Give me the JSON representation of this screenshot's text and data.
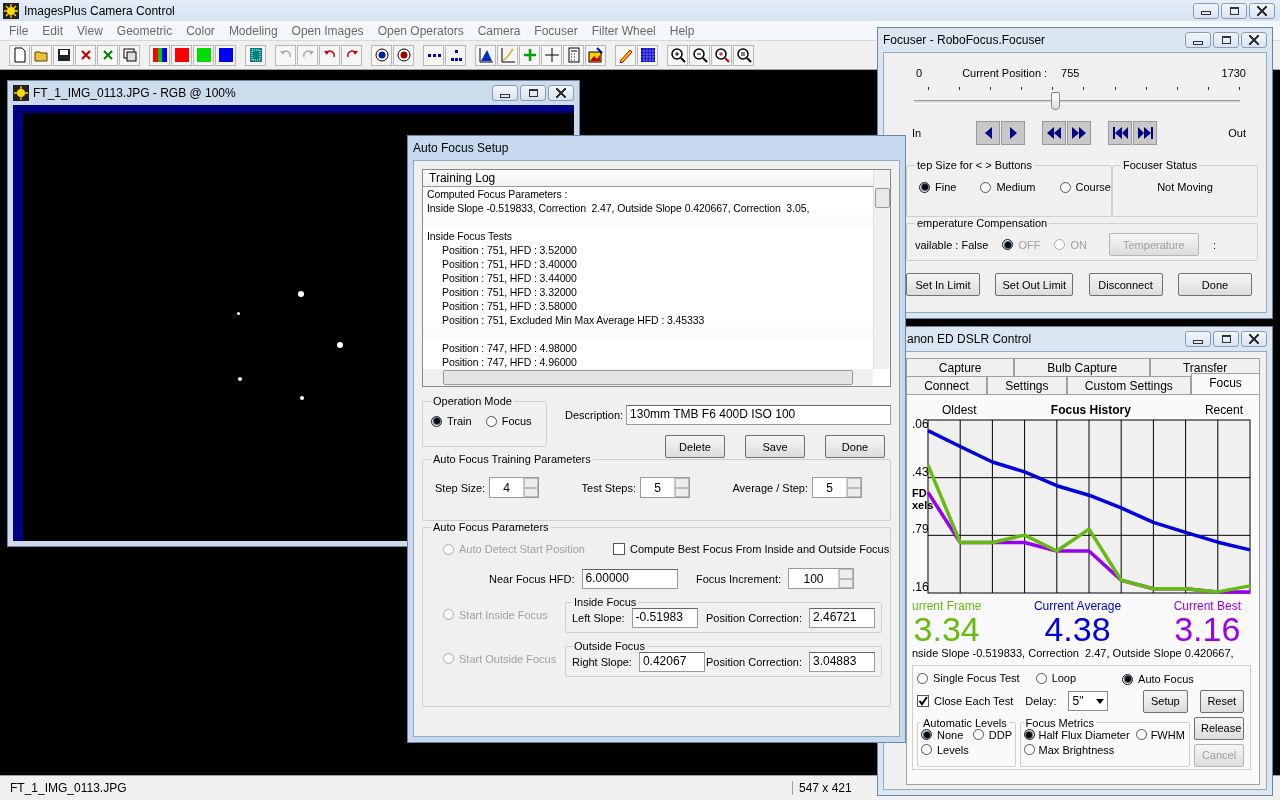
{
  "app": {
    "title": "ImagesPlus Camera Control"
  },
  "menu": [
    "File",
    "Edit",
    "View",
    "Geometric",
    "Color",
    "Modeling",
    "Open Images",
    "Open Operators",
    "Camera",
    "Focuser",
    "Filter Wheel",
    "Help"
  ],
  "image_window": {
    "title": "FT_1_IMG_0113.JPG - RGB @ 100%"
  },
  "status_bar": {
    "file_name": "FT_1_IMG_0113.JPG",
    "image_size": "547 x 421"
  },
  "auto_focus_setup": {
    "title": "Auto Focus Setup",
    "log": {
      "header": "Training Log",
      "lines": [
        {
          "kind": "heading",
          "text": "Computed Focus Parameters :",
          "gap_before": false
        },
        {
          "kind": "heading",
          "text": "Inside Slope -0.519833, Correction  2.47, Outside Slope 0.420667, Correction  3.05,",
          "gap_before": false
        },
        {
          "kind": "heading",
          "text": "Inside Focus Tests",
          "gap_before": true
        },
        {
          "kind": "entry",
          "text": "Position : 751, HFD : 3.52000",
          "gap_before": false
        },
        {
          "kind": "entry",
          "text": "Position : 751, HFD : 3.40000",
          "gap_before": false
        },
        {
          "kind": "entry",
          "text": "Position : 751, HFD : 3.44000",
          "gap_before": false
        },
        {
          "kind": "entry",
          "text": "Position : 751, HFD : 3.32000",
          "gap_before": false
        },
        {
          "kind": "entry",
          "text": "Position : 751, HFD : 3.58000",
          "gap_before": false
        },
        {
          "kind": "entry",
          "text": "Position : 751, Excluded Min Max Average HFD : 3.45333",
          "gap_before": false
        },
        {
          "kind": "entry",
          "text": "Position : 747, HFD : 4.98000",
          "gap_before": true
        },
        {
          "kind": "entry",
          "text": "Position : 747, HFD : 4.96000",
          "gap_before": false
        }
      ]
    },
    "operation_mode": {
      "label": "Operation Mode",
      "options": [
        {
          "label": "Train",
          "selected": true
        },
        {
          "label": "Focus",
          "selected": false
        }
      ]
    },
    "description": {
      "label": "Description:",
      "value": "130mm TMB F6 400D ISO 100"
    },
    "buttons": [
      "Delete",
      "Save",
      "Done"
    ],
    "training": {
      "label": "Auto Focus Training Parameters",
      "fields": [
        {
          "label": "Step Size:",
          "value": "4"
        },
        {
          "label": "Test Steps:",
          "value": "5"
        },
        {
          "label": "Average / Step:",
          "value": "5"
        }
      ]
    },
    "parameters": {
      "label": "Auto Focus Parameters",
      "auto_detect": {
        "label": "Auto Detect Start Position",
        "selected": false,
        "disabled": true
      },
      "compute_best": {
        "label": "Compute Best Focus From Inside and Outside Focus",
        "checked": false
      },
      "near_focus": {
        "label": "Near Focus HFD:",
        "value": "6.00000"
      },
      "focus_increment": {
        "label": "Focus Increment:",
        "value": "100"
      },
      "sides": [
        {
          "start": {
            "label": "Start Inside Focus",
            "selected": false,
            "disabled": true
          },
          "group": "Inside Focus",
          "slope_label": "Left Slope:",
          "slope": "-0.51983",
          "correction_label": "Position Correction:",
          "correction": "2.46721"
        },
        {
          "start": {
            "label": "Start Outside Focus",
            "selected": false,
            "disabled": true
          },
          "group": "Outside Focus",
          "slope_label": "Right Slope:",
          "slope": "0.42067",
          "correction_label": "Position Correction:",
          "correction": "3.04883"
        }
      ]
    }
  },
  "focuser": {
    "title": "Focuser - RoboFocus.Focuser",
    "scale_min": "0",
    "position_label": "Current Position :",
    "position_value": "755",
    "scale_max": "1730",
    "position": {
      "level": 0.436
    },
    "in_label": "In",
    "out_label": "Out",
    "step_size": {
      "label": "tep Size for < > Buttons",
      "options": [
        {
          "label": "Fine",
          "selected": true
        },
        {
          "label": "Medium",
          "selected": false
        },
        {
          "label": "Course",
          "selected": false
        }
      ]
    },
    "status": {
      "label": "Focuser Status",
      "value": "Not Moving"
    },
    "temperature": {
      "label": "emperature Compensation",
      "available": "vailable : False",
      "options": [
        {
          "label": "OFF",
          "selected": true,
          "disabled": true
        },
        {
          "label": "ON",
          "selected": false,
          "disabled": true
        }
      ],
      "button": {
        "label": "Temperature",
        "disabled": true
      },
      "reading": ":"
    },
    "buttons": [
      "Set In Limit",
      "Set Out Limit",
      "Disconnect",
      "Done"
    ]
  },
  "dslr": {
    "title": "anon ED DSLR Control",
    "tab_rows": [
      {
        "tabs": [
          {
            "label": "Capture",
            "selected": false
          },
          {
            "label": "Bulb Capture",
            "selected": false
          },
          {
            "label": "Transfer",
            "selected": false
          }
        ]
      },
      {
        "tabs": [
          {
            "label": "Connect",
            "selected": false
          },
          {
            "label": "Settings",
            "selected": false
          },
          {
            "label": "Custom Settings",
            "selected": false
          },
          {
            "label": "Focus",
            "selected": true
          }
        ]
      }
    ],
    "focus": {
      "x_start_label": "Oldest",
      "x_end_label": "Recent",
      "y_axis_label": [
        "FD",
        "xels"
      ],
      "chart_title": "Focus History",
      "y_tick_labels": [
        ".06",
        ".43",
        ".79",
        ".16"
      ],
      "readouts": [
        {
          "label": "urrent Frame",
          "value": "3.34",
          "color": "#66bb11"
        },
        {
          "label": "Current Average",
          "value": "4.38",
          "color": "#0000e0"
        },
        {
          "label": "Current Best",
          "value": "3.16",
          "color": "#9900ee"
        }
      ],
      "summary": "nside Slope -0.519833, Correction  2.47, Outside Slope 0.420667,",
      "modes": [
        {
          "label": "Single Focus Test",
          "selected": false
        },
        {
          "label": "Loop",
          "selected": false
        },
        {
          "label": "Auto Focus",
          "selected": true
        }
      ],
      "close_each_test": {
        "label": "Close Each Test",
        "checked": true
      },
      "delay": {
        "label": "Delay:",
        "value": "5\""
      },
      "buttons": [
        "Setup",
        "Reset"
      ],
      "levels": {
        "label": "Automatic Levels",
        "options": [
          {
            "label": "None",
            "selected": true
          },
          {
            "label": "DDP",
            "selected": false
          },
          {
            "label": "Levels",
            "selected": false
          }
        ]
      },
      "metrics": {
        "label": "Focus Metrics",
        "options": [
          {
            "label": "Half Flux Diameter",
            "selected": true
          },
          {
            "label": "FWHM",
            "selected": false
          },
          {
            "label": "Max Brightness",
            "selected": false
          }
        ]
      },
      "side_buttons": [
        {
          "label": "Release",
          "disabled": false
        },
        {
          "label": "Cancel",
          "disabled": true
        }
      ]
    }
  }
}
